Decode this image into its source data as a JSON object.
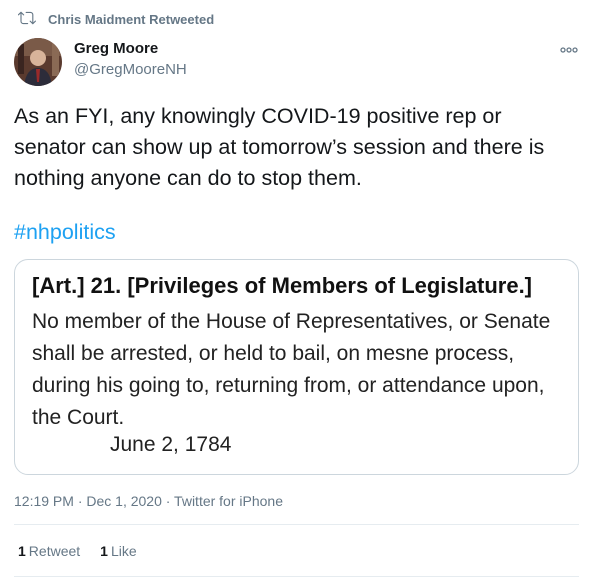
{
  "retweet_banner": {
    "icon": "retweet-icon",
    "text": "Chris Maidment Retweeted"
  },
  "author": {
    "name": "Greg Moore",
    "handle": "@GregMooreNH"
  },
  "tweet": {
    "text": "As an FYI, any knowingly COVID-19 positive rep or senator can show up at tomorrow’s session and there is nothing anyone can do to stop them.",
    "hashtag": "#nhpolitics"
  },
  "image_card": {
    "heading": "[Art.] 21. [Privileges of Members of Legislature.]",
    "body": "No member of the House of Representatives, or Senate shall be arrested, or held to bail, on mesne process, during his going to, returning from, or attendance upon, the Court.",
    "date": "June 2, 1784"
  },
  "meta": {
    "text": "12:19 PM · Dec 1, 2020 · Twitter for iPhone"
  },
  "stats": {
    "retweets_count": "1",
    "retweets_label": "Retweet",
    "likes_count": "1",
    "likes_label": "Like"
  },
  "colors": {
    "accent": "#1da1f2",
    "secondary_text": "#657786",
    "border": "#ccd6dd"
  }
}
